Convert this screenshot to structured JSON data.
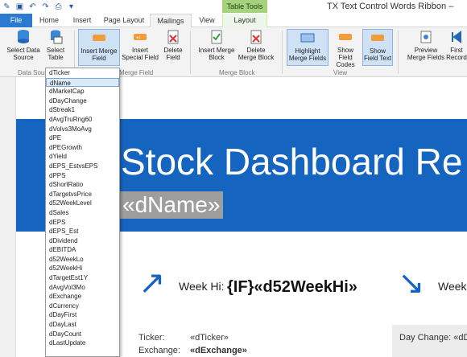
{
  "window": {
    "title": "TX Text Control Words Ribbon –",
    "contextual_tab": "Table Tools"
  },
  "quick_access": {
    "items": [
      "app-icon",
      "save-icon",
      "undo-icon",
      "redo-icon",
      "print-icon",
      "customize-icon"
    ]
  },
  "tabs": [
    "File",
    "Home",
    "Insert",
    "Page Layout",
    "Mailings",
    "View",
    "Layout"
  ],
  "ribbon": {
    "select_data_source": "Select Data Source",
    "select_table": "Select Table",
    "insert_merge_field": "Insert Merge Field",
    "insert_special_field": "Insert Special Field",
    "delete_field": "Delete Field",
    "insert_merge_block": "Insert Merge Block",
    "delete_merge_block": "Delete Merge Block",
    "highlight_merge_fields": "Highlight Merge Fields",
    "show_field_codes": "Show Field Codes",
    "show_field_text": "Show Field Text",
    "preview_merge_fields": "Preview Merge Fields",
    "first_record": "First Record",
    "groups": {
      "data_source": "Data Source",
      "merge_field": "Merge Field",
      "merge_block": "Merge Block",
      "view": "View"
    }
  },
  "dropdown": {
    "selected": "dName",
    "items": [
      "dTicker",
      "dName",
      "dMarketCap",
      "dDayChange",
      "dStreak1",
      "dAvgTruRng60",
      "dVolvs3MoAvg",
      "dPE",
      "dPEGrowth",
      "dYield",
      "dEPS_EstvsEPS",
      "dPPS",
      "dShortRatio",
      "dTargetvsPrice",
      "d52WeekLevel",
      "dSales",
      "dEPS",
      "dEPS_Est",
      "dDividend",
      "dEBITDA",
      "d52WeekLo",
      "d52WeekHi",
      "dTargetEst1Y",
      "dAvgVol3Mo",
      "dExchange",
      "dCurrency",
      "dDayFirst",
      "dDayLast",
      "dDayCount",
      "dLastUpdate"
    ]
  },
  "document": {
    "title": "Stock Dashboard Re",
    "name_field": "«dName»",
    "week_hi_label": "Week Hi:",
    "week_hi_field": "{IF}«d52WeekHi»",
    "week_lo_label": "Week",
    "ticker_label": "Ticker:",
    "ticker_value": "«dTicker»",
    "exchange_label": "Exchange:",
    "exchange_value": "«dExchange»",
    "day_change_label": "Day Change: «dDa"
  },
  "colors": {
    "accent": "#1565c0",
    "file_tab": "#2b79d0",
    "contextual_tab": "#a5d27d"
  }
}
